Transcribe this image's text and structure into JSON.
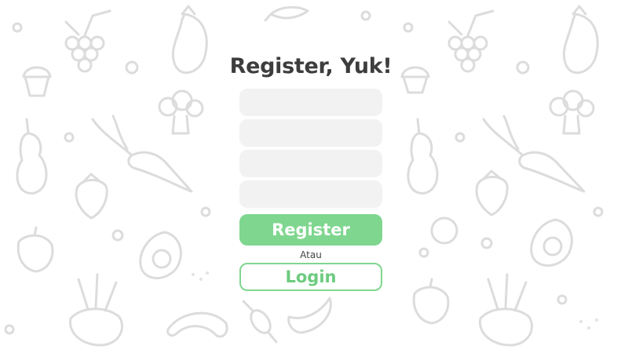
{
  "form": {
    "title": "Register, Yuk!",
    "fields": [
      {
        "placeholder": ""
      },
      {
        "placeholder": ""
      },
      {
        "placeholder": ""
      },
      {
        "placeholder": ""
      }
    ],
    "register_label": "Register",
    "separator": "Atau",
    "login_label": "Login"
  },
  "colors": {
    "accent": "#7fd68f",
    "title": "#3d3d3d",
    "field_bg": "#f2f2f2",
    "doodle": "#dcdcdc"
  },
  "background": {
    "pattern_icons": [
      "grapes-icon",
      "eggplant-icon",
      "cupcake-icon",
      "broccoli-icon",
      "pear-icon",
      "carrot-icon",
      "strawberry-icon",
      "bell-pepper-icon",
      "avocado-icon",
      "beet-icon",
      "croissant-icon",
      "candy-icon",
      "banana-icon",
      "mushroom-icon"
    ]
  }
}
